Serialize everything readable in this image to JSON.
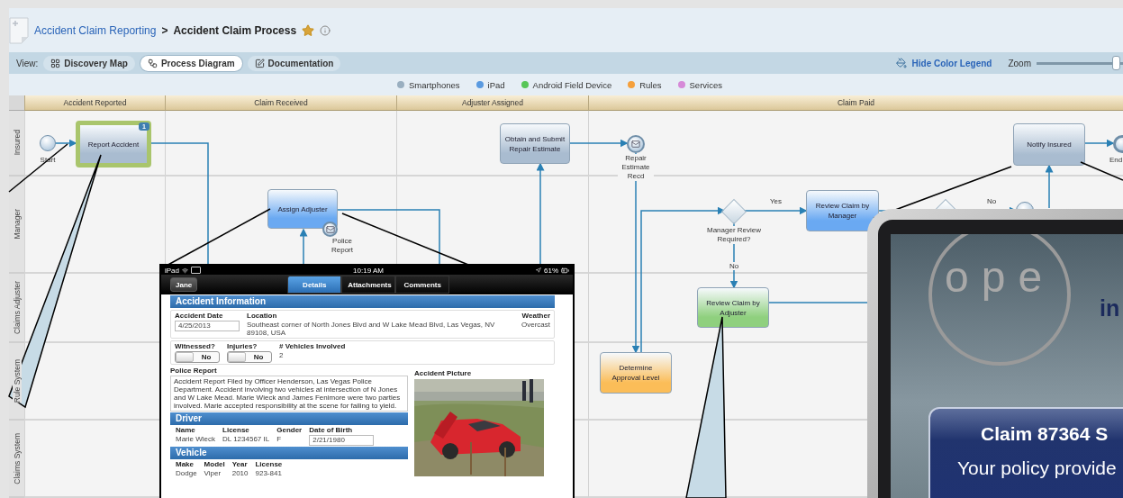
{
  "breadcrumb": {
    "parent": "Accident Claim Reporting",
    "separator": ">",
    "title": "Accident Claim Process",
    "favorite": true
  },
  "view_bar": {
    "label": "View:",
    "views": [
      {
        "label": "Discovery Map",
        "kind": "grid",
        "selected": false
      },
      {
        "label": "Process Diagram",
        "kind": "flow",
        "selected": true
      },
      {
        "label": "Documentation",
        "kind": "doc",
        "selected": false
      }
    ],
    "legend_toggle": "Hide Color Legend",
    "zoom": {
      "label": "Zoom",
      "level": 0.96
    }
  },
  "color_legend": [
    {
      "label": "Smartphones",
      "color": "#9aafc0"
    },
    {
      "label": "iPad",
      "color": "#5a9ae0"
    },
    {
      "label": "Android Field Device",
      "color": "#58c658"
    },
    {
      "label": "Rules",
      "color": "#f5a03c"
    },
    {
      "label": "Services",
      "color": "#d68ad8"
    }
  ],
  "diagram": {
    "columns": [
      "Accident Reported",
      "Claim Received",
      "Adjuster Assigned",
      "Claim Paid"
    ],
    "lanes": [
      "Insured",
      "Manager",
      "Claims Adjuster",
      "Rule System",
      "Claims System"
    ],
    "nodes": [
      {
        "kind": "start",
        "label": "Start"
      },
      {
        "kind": "task",
        "label": "Report Accident",
        "color": "#a9bcd0",
        "highlighted": true,
        "badge": "1"
      },
      {
        "kind": "task",
        "label": "Assign Adjuster",
        "color": "#6aa9f2",
        "highlighted": false
      },
      {
        "kind": "message",
        "label": "Police Report"
      },
      {
        "kind": "task",
        "label": "Obtain and Submit Repair Estimate",
        "color": "#a9bcd0",
        "highlighted": false
      },
      {
        "kind": "message",
        "label": "Repair Estimate Recd"
      },
      {
        "kind": "gateway",
        "label": "Manager Review Required?"
      },
      {
        "kind": "task",
        "label": "Review Claim by Manager",
        "color": "#6aa9f2",
        "highlighted": false
      },
      {
        "kind": "task",
        "label": "Review Claim by Adjuster",
        "color": "#8fd07e",
        "highlighted": false
      },
      {
        "kind": "task",
        "label": "Determine Approval Level",
        "color": "#fbbd58",
        "highlighted": false
      },
      {
        "kind": "task",
        "label": "Notify Insured",
        "color": "#a9bcd0",
        "highlighted": false
      },
      {
        "kind": "end",
        "label": "End"
      },
      {
        "kind": "gateway"
      },
      {
        "kind": "event"
      }
    ],
    "flow_labels": [
      "Yes",
      "No",
      "No"
    ]
  },
  "ipad_screen": {
    "device": "iPad",
    "time": "10:19 AM",
    "battery": "61%",
    "user_button": "Jane",
    "tabs": [
      {
        "label": "Details",
        "selected": true
      },
      {
        "label": "Attachments",
        "selected": false
      },
      {
        "label": "Comments",
        "selected": false
      }
    ],
    "accident_information": {
      "title": "Accident Information",
      "accident_date": {
        "label": "Accident Date",
        "value": "4/25/2013"
      },
      "location": {
        "label": "Location",
        "value": "Southeast corner of North Jones Blvd and W Lake Mead Blvd, Las Vegas, NV 89108, USA"
      },
      "weather": {
        "label": "Weather",
        "value": "Overcast"
      },
      "toggles": [
        {
          "label": "Witnessed?",
          "value": "No",
          "on": false
        },
        {
          "label": "Injuries?",
          "value": "No",
          "on": false
        }
      ],
      "vehicles": {
        "label": "# Vehicles Involved",
        "value": "2"
      },
      "police_report": {
        "label": "Police Report",
        "value": "Accident Report Filed by Officer Henderson, Las Vegas Police Department. Accident involving two vehicles at intersection of N Jones and W Lake Mead. Marie Wieck and James Fenimore were two parties involved.  Marie accepted responsibility at the scene for failing to yield."
      },
      "picture_label": "Accident Picture"
    },
    "driver": {
      "title": "Driver",
      "fields": [
        {
          "label": "Name",
          "value": "Marie Wieck",
          "kind": "text"
        },
        {
          "label": "License",
          "value": "DL 1234567 IL",
          "kind": "text"
        },
        {
          "label": "Gender",
          "value": "F",
          "kind": "text"
        },
        {
          "label": "Date of Birth",
          "value": "2/21/1980",
          "kind": "input"
        }
      ]
    },
    "vehicle": {
      "title": "Vehicle",
      "fields": [
        {
          "label": "Make",
          "value": "Dodge",
          "kind": "text"
        },
        {
          "label": "Model",
          "value": "Viper",
          "kind": "text"
        },
        {
          "label": "Year",
          "value": "2010",
          "kind": "text"
        },
        {
          "label": "License",
          "value": "923-841",
          "kind": "text"
        }
      ]
    }
  },
  "phone_screen": {
    "logo": "ope",
    "logo_tail": "in",
    "card_title": "Claim 87364 S",
    "card_text": "Your policy provide"
  }
}
